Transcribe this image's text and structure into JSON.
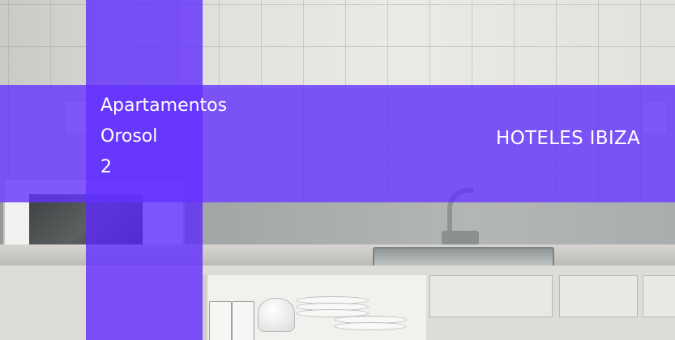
{
  "banner": {
    "title_lines": [
      "Apartamentos",
      "Orosol",
      "2"
    ],
    "category_label": "HOTELES IBIZA"
  },
  "colors": {
    "overlay": "#5e28ff",
    "text": "#ffffff"
  }
}
